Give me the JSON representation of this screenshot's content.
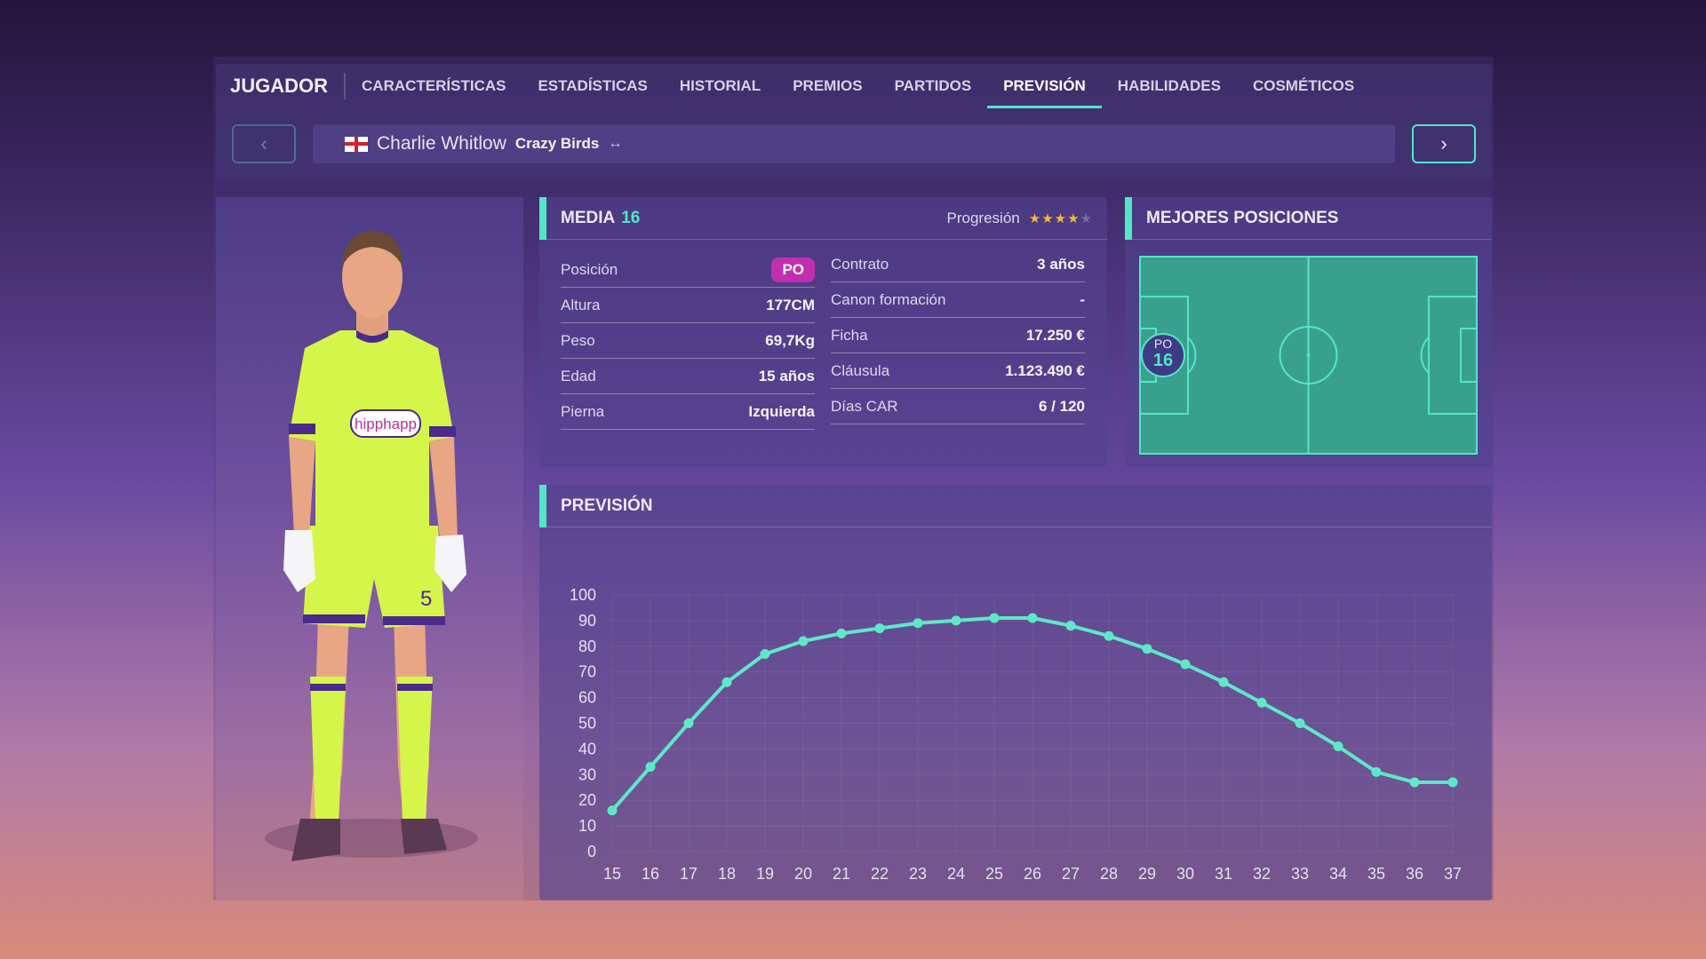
{
  "tabs": {
    "title": "JUGADOR",
    "items": [
      "CARACTERÍSTICAS",
      "ESTADÍSTICAS",
      "HISTORIAL",
      "PREMIOS",
      "PARTIDOS",
      "PREVISIÓN",
      "HABILIDADES",
      "COSMÉTICOS"
    ],
    "active_index": 5
  },
  "player": {
    "name": "Charlie Whitlow",
    "team": "Crazy Birds",
    "swap_glyph": "↔",
    "prev_glyph": "‹",
    "next_glyph": "›",
    "flag_icon": "england-flag-icon",
    "shirt_sponsor": "hipphapp",
    "shirt_number": "5",
    "kit_color": "#d6f54a"
  },
  "media": {
    "label": "MEDIA",
    "value": "16",
    "progression_label": "Progresión",
    "stars_filled": 4,
    "stars_total": 5,
    "left_stats": [
      {
        "label": "Posición",
        "value": "PO",
        "badge": true
      },
      {
        "label": "Altura",
        "value": "177CM"
      },
      {
        "label": "Peso",
        "value": "69,7Kg"
      },
      {
        "label": "Edad",
        "value": "15 años"
      },
      {
        "label": "Pierna",
        "value": "Izquierda"
      }
    ],
    "right_stats": [
      {
        "label": "Contrato",
        "value": "3 años"
      },
      {
        "label": "Canon formación",
        "value": "-"
      },
      {
        "label": "Ficha",
        "value": "17.250 €"
      },
      {
        "label": "Cláusula",
        "value": "1.123.490 €"
      },
      {
        "label": "Días CAR",
        "value": "6 / 120"
      }
    ]
  },
  "best_positions": {
    "title": "MEJORES POSICIONES",
    "marker_position": "PO",
    "marker_rating": "16",
    "pitch_color": "#3aa08e",
    "line_color": "#52e6c8"
  },
  "forecast": {
    "title": "PREVISIÓN"
  },
  "chart_data": {
    "type": "line",
    "title": "PREVISIÓN",
    "xlabel": "",
    "ylabel": "",
    "x": [
      15,
      16,
      17,
      18,
      19,
      20,
      21,
      22,
      23,
      24,
      25,
      26,
      27,
      28,
      29,
      30,
      31,
      32,
      33,
      34,
      35,
      36,
      37
    ],
    "values": [
      16,
      33,
      50,
      66,
      77,
      82,
      85,
      87,
      89,
      90,
      91,
      91,
      88,
      84,
      79,
      73,
      66,
      58,
      50,
      41,
      31,
      27,
      27
    ],
    "yticks": [
      0,
      10,
      20,
      30,
      40,
      50,
      60,
      70,
      80,
      90,
      100
    ],
    "ylim": [
      0,
      100
    ],
    "grid": true,
    "color": "#5ee8c8"
  }
}
